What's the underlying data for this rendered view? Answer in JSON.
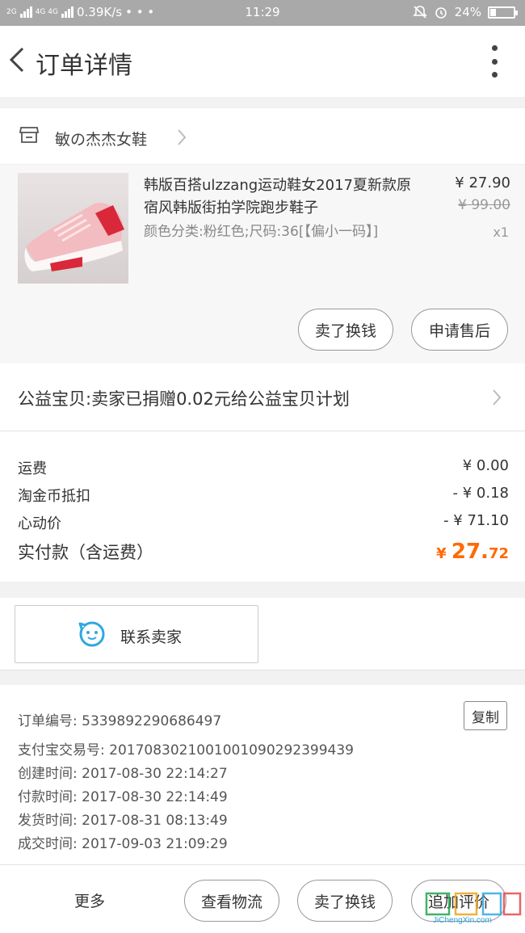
{
  "status_bar": {
    "network_left": "2G",
    "network_right": "4G 4G",
    "speed": "0.39K/s",
    "dots": "• • •",
    "time": "11:29",
    "battery": "24%",
    "battery_level": 0.24
  },
  "header": {
    "title": "订单详情"
  },
  "shop": {
    "name": "敏の杰杰女鞋"
  },
  "item": {
    "title": "韩版百搭ulzzang运动鞋女2017夏新款原宿风韩版街拍学院跑步鞋子",
    "sku": "颜色分类:粉红色;尺码:36[【偏小一码】]",
    "price": "¥ 27.90",
    "original_price": "¥ 99.00",
    "quantity": "x1",
    "sell_button": "卖了换钱",
    "after_sale_button": "申请售后"
  },
  "charity": {
    "text": "公益宝贝:卖家已捐赠0.02元给公益宝贝计划"
  },
  "fees": [
    {
      "label": "运费",
      "value": "¥ 0.00"
    },
    {
      "label": "淘金币抵扣",
      "value": "- ¥ 0.18"
    },
    {
      "label": "心动价",
      "value": "- ¥ 71.10"
    }
  ],
  "total": {
    "label": "实付款（含运费）",
    "currency": "¥ ",
    "integer": "27.",
    "decimal": "72"
  },
  "contact": {
    "label": "联系卖家"
  },
  "order_info": {
    "order_no": "订单编号: 5339892290686497",
    "alipay_no": "支付宝交易号: 2017083021001001090292399439",
    "created": "创建时间: 2017-08-30 22:14:27",
    "paid": "付款时间: 2017-08-30 22:14:49",
    "shipped": "发货时间: 2017-08-31 08:13:49",
    "completed": "成交时间: 2017-09-03 21:09:29",
    "copy_button": "复制"
  },
  "bottom": {
    "more": "更多",
    "logistics": "查看物流",
    "sell": "卖了换钱",
    "review": "追加评价"
  },
  "watermark": {
    "text": "JiChengXin.com"
  },
  "colors": {
    "accent": "#ff6a00",
    "chat_icon": "#2fa8e0",
    "status_bar": "#a9a9a9"
  }
}
